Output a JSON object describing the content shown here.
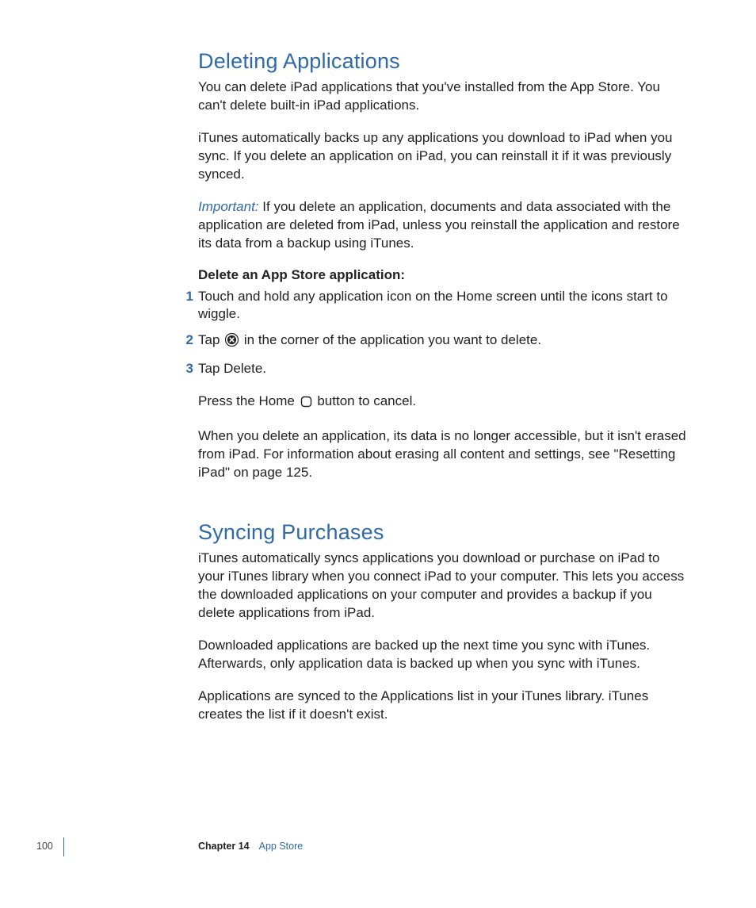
{
  "section1": {
    "heading": "Deleting Applications",
    "p1": "You can delete iPad applications that you've installed from the App Store. You can't delete built-in iPad applications.",
    "p2": "iTunes automatically backs up any applications you download to iPad when you sync. If you delete an application on iPad, you can reinstall it if it was previously synced.",
    "important_label": "Important:",
    "important_text": "  If you delete an application, documents and data associated with the application are deleted from iPad, unless you reinstall the application and restore its data from a backup using iTunes.",
    "subhead": "Delete an App Store application:",
    "steps": {
      "n1": "1",
      "s1": "Touch and hold any application icon on the Home screen until the icons start to wiggle.",
      "n2": "2",
      "s2a": "Tap ",
      "s2b": " in the corner of the application you want to delete.",
      "n3": "3",
      "s3": "Tap Delete."
    },
    "p3a": "Press the Home ",
    "p3b": " button to cancel.",
    "p4": "When you delete an application, its data is no longer accessible, but it isn't erased from iPad. For information about erasing all content and settings, see \"Resetting iPad\" on page 125."
  },
  "section2": {
    "heading": "Syncing Purchases",
    "p1": "iTunes automatically syncs applications you download or purchase on iPad to your iTunes library when you connect iPad to your computer. This lets you access the downloaded applications on your computer and provides a backup if you delete applications from iPad.",
    "p2": "Downloaded applications are backed up the next time you sync with iTunes. Afterwards, only application data is backed up when you sync with iTunes.",
    "p3": "Applications are synced to the Applications list in your iTunes library. iTunes creates the list if it doesn't exist."
  },
  "footer": {
    "page": "100",
    "chapter_label": "Chapter 14",
    "chapter_title": "App Store"
  }
}
